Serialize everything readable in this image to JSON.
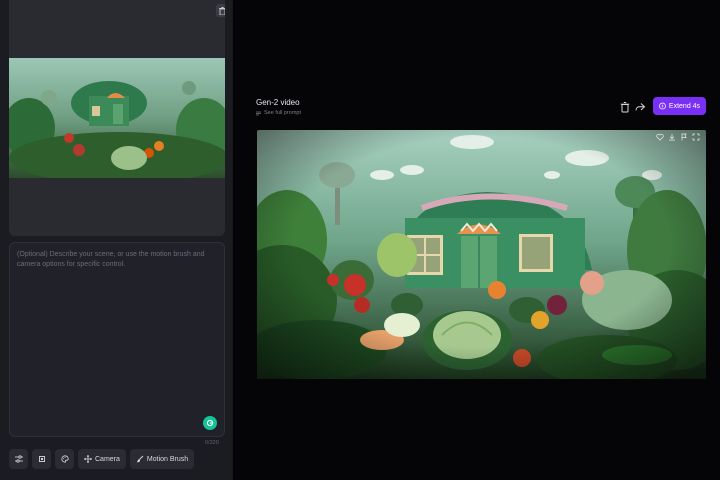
{
  "left_panel": {
    "prompt_placeholder": "(Optional) Describe your scene, or use the motion brush and camera options for specific control.",
    "char_counter": "0/320",
    "toolbar": {
      "camera_label": "Camera",
      "motion_brush_label": "Motion Brush"
    }
  },
  "output": {
    "title": "Gen-2 video",
    "see_prompt": "See full prompt",
    "extend_label": "Extend 4s"
  },
  "colors": {
    "accent": "#7a2ff7",
    "panel_bg": "#1b1c22",
    "page_bg": "#050507"
  },
  "icons": [
    "trash-icon",
    "share-icon",
    "bolt-icon",
    "heart-icon",
    "download-icon",
    "flag-icon",
    "fullscreen-icon",
    "sliders-icon",
    "grammarly-icon",
    "camera-move-icon",
    "motion-brush-icon",
    "palette-icon",
    "frame-icon"
  ]
}
